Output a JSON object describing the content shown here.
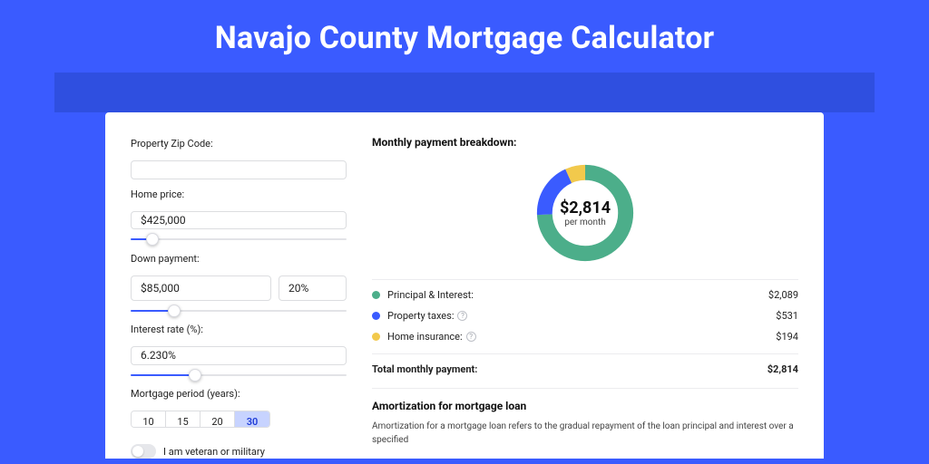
{
  "title": "Navajo County Mortgage Calculator",
  "form": {
    "zip_label": "Property Zip Code:",
    "zip_value": "",
    "home_price_label": "Home price:",
    "home_price_value": "$425,000",
    "home_price_slider_pct": 10,
    "down_payment_label": "Down payment:",
    "down_payment_value": "$85,000",
    "down_payment_pct_value": "20%",
    "down_payment_slider_pct": 20,
    "rate_label": "Interest rate (%):",
    "rate_value": "6.230%",
    "rate_slider_pct": 30,
    "period_label": "Mortgage period (years):",
    "periods": [
      "10",
      "15",
      "20",
      "30"
    ],
    "period_selected_index": 3,
    "veteran_label": "I am veteran or military",
    "veteran_on": false
  },
  "breakdown": {
    "title": "Monthly payment breakdown:",
    "center_value": "$2,814",
    "center_sub": "per month",
    "items": [
      {
        "name": "Principal & Interest:",
        "amount": "$2,089",
        "color": "#4cae8a",
        "info": false
      },
      {
        "name": "Property taxes:",
        "amount": "$531",
        "color": "#3a5bff",
        "info": true
      },
      {
        "name": "Home insurance:",
        "amount": "$194",
        "color": "#f2c94c",
        "info": true
      }
    ],
    "total_label": "Total monthly payment:",
    "total_amount": "$2,814"
  },
  "amort": {
    "title": "Amortization for mortgage loan",
    "text": "Amortization for a mortgage loan refers to the gradual repayment of the loan principal and interest over a specified"
  },
  "chart_data": {
    "type": "pie",
    "title": "Monthly payment breakdown",
    "series": [
      {
        "name": "Principal & Interest",
        "value": 2089,
        "color": "#4cae8a"
      },
      {
        "name": "Property taxes",
        "value": 531,
        "color": "#3a5bff"
      },
      {
        "name": "Home insurance",
        "value": 194,
        "color": "#f2c94c"
      }
    ],
    "total": 2814
  }
}
